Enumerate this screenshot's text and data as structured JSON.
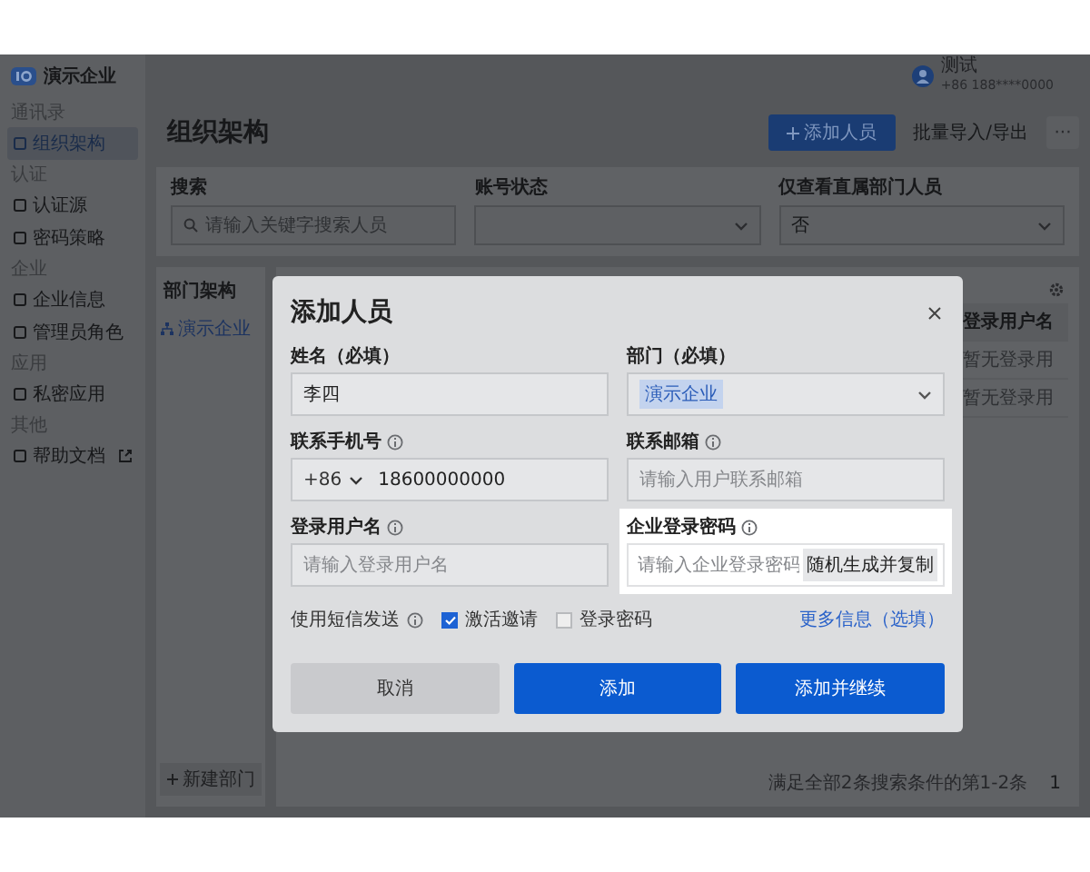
{
  "app": {
    "org_name": "演示企业",
    "user": {
      "name": "测试",
      "phone": "+86 188****0000"
    }
  },
  "sidebar": {
    "sections": [
      {
        "heading": "通讯录",
        "items": [
          {
            "label": "组织架构",
            "selected": true,
            "external": false
          }
        ]
      },
      {
        "heading": "认证",
        "items": [
          {
            "label": "认证源",
            "selected": false,
            "external": false
          },
          {
            "label": "密码策略",
            "selected": false,
            "external": false
          }
        ]
      },
      {
        "heading": "企业",
        "items": [
          {
            "label": "企业信息",
            "selected": false,
            "external": false
          },
          {
            "label": "管理员角色",
            "selected": false,
            "external": false
          }
        ]
      },
      {
        "heading": "应用",
        "items": [
          {
            "label": "私密应用",
            "selected": false,
            "external": false
          }
        ]
      },
      {
        "heading": "其他",
        "items": [
          {
            "label": "帮助文档",
            "selected": false,
            "external": true
          }
        ]
      }
    ]
  },
  "main": {
    "title": "组织架构",
    "add_button": "添加人员",
    "import_button": "批量导入/导出",
    "more_button": "···",
    "filters": [
      {
        "label": "搜索",
        "kind": "search",
        "placeholder": "请输入关键字搜索人员"
      },
      {
        "label": "账号状态",
        "kind": "select"
      },
      {
        "label": "仅查看直属部门人员",
        "kind": "select",
        "value": "否"
      }
    ],
    "departments": {
      "title": "部门架构",
      "tree": [
        {
          "label": "演示企业",
          "selected": true
        }
      ],
      "add_button": "新建部门"
    },
    "table": {
      "columns": [
        "登录用户名"
      ],
      "rows": [
        [
          "暂无登录用"
        ],
        [
          "暂无登录用"
        ]
      ],
      "summary": "满足全部2条搜索条件的第1-2条",
      "page": "1"
    }
  },
  "modal": {
    "title": "添加人员",
    "fields": [
      {
        "label": "姓名（必填）",
        "help": false,
        "kind": "text",
        "value": "李四"
      },
      {
        "label": "部门（必填）",
        "help": false,
        "kind": "select",
        "value": "演示企业"
      },
      {
        "label": "联系手机号",
        "help": true,
        "kind": "phone",
        "prefix": "+86",
        "value": "18600000000"
      },
      {
        "label": "联系邮箱",
        "help": true,
        "kind": "text",
        "placeholder": "请输入用户联系邮箱"
      },
      {
        "label": "登录用户名",
        "help": true,
        "kind": "text",
        "placeholder": "请输入登录用户名"
      },
      {
        "label": "企业登录密码",
        "help": true,
        "kind": "password",
        "placeholder": "请输入企业登录密码",
        "action": "随机生成并复制",
        "highlighted": true
      }
    ],
    "sms": {
      "label": "使用短信发送",
      "help": true,
      "options": [
        {
          "label": "激活邀请",
          "checked": true
        },
        {
          "label": "登录密码",
          "checked": false
        }
      ]
    },
    "more_link": "更多信息（选填）",
    "buttons": [
      {
        "label": "取消",
        "kind": "secondary"
      },
      {
        "label": "添加",
        "kind": "primary"
      },
      {
        "label": "添加并继续",
        "kind": "primary"
      }
    ]
  }
}
